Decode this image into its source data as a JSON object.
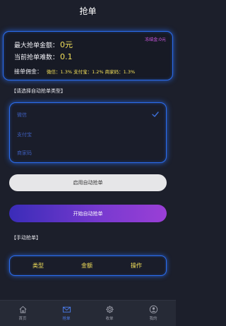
{
  "header": {
    "title": "抢单"
  },
  "info": {
    "max_label": "最大抢单金额：",
    "max_value": "0元",
    "count_label": "当前抢单难数：",
    "count_value": "0.1",
    "frozen": "冻结金:0元",
    "commission_label": "接单佣金：",
    "commission_value": "微信：1.3% 支付宝：1.2% 商家码：1.3%"
  },
  "auto_section": {
    "label": "【请选择自动抢单类型】",
    "options": [
      "微信",
      "支付宝",
      "商家码"
    ]
  },
  "buttons": {
    "enable_auto": "启用自动抢单",
    "start_auto": "开始自动抢单"
  },
  "manual_section": {
    "label": "【手动抢单】",
    "columns": [
      "类型",
      "金额",
      "操作"
    ]
  },
  "tabbar": {
    "items": [
      {
        "label": "首页",
        "icon": "home-icon"
      },
      {
        "label": "抢单",
        "icon": "mail-icon"
      },
      {
        "label": "收单",
        "icon": "gear-icon"
      },
      {
        "label": "我的",
        "icon": "user-icon"
      }
    ],
    "active_index": 1
  },
  "colors": {
    "background": "#1c1f2b",
    "accent_blue": "#2b6df0",
    "value_yellow": "#f4e15a",
    "frozen_pink": "#d95cf0"
  }
}
